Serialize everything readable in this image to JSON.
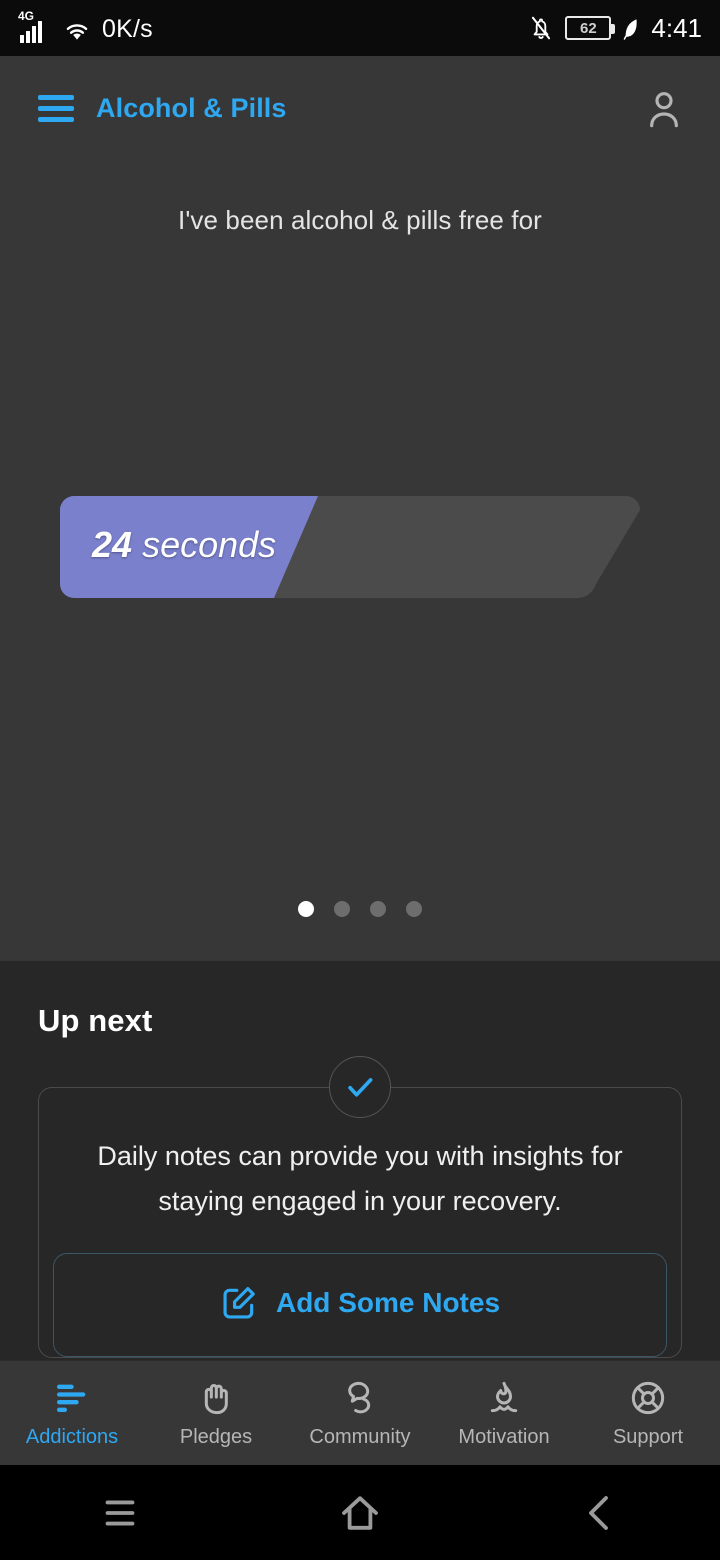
{
  "status_bar": {
    "network_type": "4G",
    "signal_icon": "signal-bars-icon",
    "wifi_icon": "wifi-icon",
    "network_speed": "0K/s",
    "silent_icon": "bell-muted-icon",
    "battery_level": "62",
    "eco_icon": "leaf-icon",
    "time": "4:41"
  },
  "header": {
    "menu_icon": "hamburger-menu-icon",
    "title": "Alcohol & Pills",
    "profile_icon": "user-account-icon"
  },
  "carousel": {
    "caption": "I've been alcohol & pills free for",
    "counter_value": "24",
    "counter_unit": "seconds",
    "progress_percent": 43,
    "fill_color": "#7a80cc",
    "track_color": "#4b4b4b",
    "dots": [
      {
        "active": true
      },
      {
        "active": false
      },
      {
        "active": false
      },
      {
        "active": false
      }
    ]
  },
  "up_next": {
    "section_title": "Up next",
    "check_icon": "check-circle-icon",
    "card_text": "Daily notes can provide you with insights for staying engaged in your recovery.",
    "action_icon": "edit-note-icon",
    "action_label": "Add Some Notes"
  },
  "bottom_nav": {
    "items": [
      {
        "label": "Addictions",
        "icon": "bar-chart-icon",
        "active": true
      },
      {
        "label": "Pledges",
        "icon": "hand-raised-icon",
        "active": false
      },
      {
        "label": "Community",
        "icon": "speech-bubbles-icon",
        "active": false
      },
      {
        "label": "Motivation",
        "icon": "campfire-flame-icon",
        "active": false
      },
      {
        "label": "Support",
        "icon": "life-ring-icon",
        "active": false
      }
    ],
    "active_color": "#2fa8f2",
    "inactive_color": "#b6b6b6"
  },
  "system_nav": {
    "recents_icon": "recents-icon",
    "home_icon": "home-icon",
    "back_icon": "back-chevron-icon"
  }
}
